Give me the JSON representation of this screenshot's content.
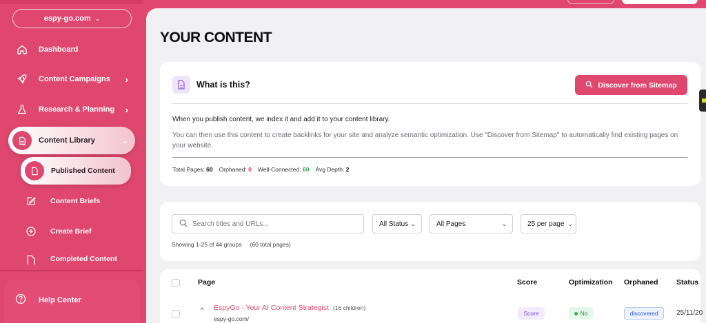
{
  "sidebar": {
    "domain": "espy-go.com",
    "nav": [
      {
        "label": "Dashboard"
      },
      {
        "label": "Content Campaigns"
      },
      {
        "label": "Research & Planning"
      },
      {
        "label": "Content Library"
      }
    ],
    "sub": [
      {
        "label": "Published Content"
      },
      {
        "label": "Content Briefs"
      },
      {
        "label": "Create Brief"
      },
      {
        "label": "Completed Content"
      }
    ],
    "help": "Help Center"
  },
  "page": {
    "title": "YOUR CONTENT"
  },
  "info_card": {
    "heading": "What is this?",
    "sitemap_button": "Discover from Sitemap",
    "desc1": "When you publish content, we index it and add it to your content library.",
    "desc2": "You can then use this content to create backlinks for your site and analyze semantic optimization. Use \"Discover from Sitemap\" to automatically find existing pages on your website.",
    "stats": {
      "total_label": "Total Pages:",
      "total": "60",
      "orphaned_label": "Orphaned:",
      "orphaned": "0",
      "connected_label": "Well-Connected:",
      "connected": "60",
      "depth_label": "Avg Depth:",
      "depth": "2"
    }
  },
  "filters": {
    "search_placeholder": "Search titles and URLs...",
    "status": "All Status",
    "pages": "All Pages",
    "per_page": "25 per page",
    "showing": "Showing 1-25 of 44 groups",
    "total_pages": "(60 total pages)"
  },
  "table": {
    "headers": {
      "page": "Page",
      "score": "Score",
      "optimization": "Optimization",
      "orphaned": "Orphaned",
      "status": "Status"
    },
    "rows": [
      {
        "title": "EspyGo - Your AI Content Strategist",
        "children": "(16 children)",
        "url": "espy-go.com/",
        "score": "Score",
        "optimization": "No",
        "orphaned": "discovered",
        "date": "25/11/20"
      }
    ]
  },
  "colors": {
    "brand": "#e0476f",
    "green": "#2fa34a",
    "red": "#e0304f"
  }
}
